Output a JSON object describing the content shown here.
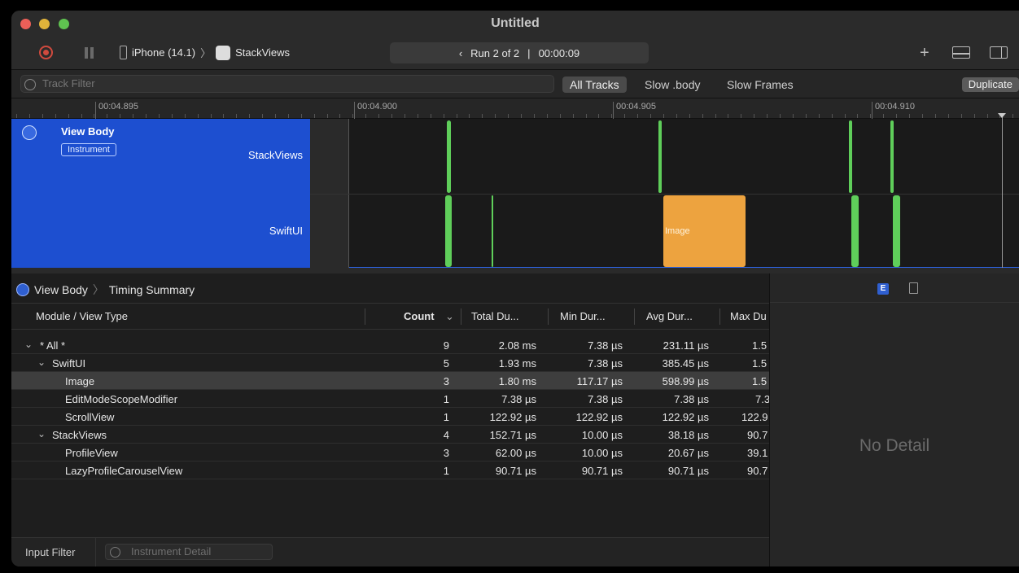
{
  "window": {
    "title": "Untitled"
  },
  "toolbar": {
    "device": "iPhone (14.1)",
    "app": "StackViews",
    "run_label": "Run 2 of 2",
    "run_separator": "|",
    "run_time": "00:00:09",
    "run_prev": "‹"
  },
  "filter": {
    "placeholder": "Track Filter",
    "tabs": [
      "All Tracks",
      "Slow .body",
      "Slow Frames"
    ],
    "duplicate": "Duplicate"
  },
  "ruler": {
    "ticks": [
      "00:04.895",
      "00:04.900",
      "00:04.905",
      "00:04.910"
    ]
  },
  "track": {
    "title": "View Body",
    "badge": "Instrument",
    "lanes": [
      "StackViews",
      "SwiftUI"
    ],
    "block_label": "Image"
  },
  "summary": {
    "breadcrumb": [
      "View Body",
      "Timing Summary"
    ],
    "columns": {
      "module": "Module / View Type",
      "count": "Count",
      "total": "Total Du...",
      "min": "Min Dur...",
      "avg": "Avg Dur...",
      "max": "Max Du"
    },
    "rows": [
      {
        "name": "* All *",
        "count": "9",
        "total": "2.08 ms",
        "min": "7.38 µs",
        "avg": "231.11 µs",
        "max": "1.5"
      },
      {
        "name": "SwiftUI",
        "count": "5",
        "total": "1.93 ms",
        "min": "7.38 µs",
        "avg": "385.45 µs",
        "max": "1.5"
      },
      {
        "name": "Image",
        "count": "3",
        "total": "1.80 ms",
        "min": "117.17 µs",
        "avg": "598.99 µs",
        "max": "1.5"
      },
      {
        "name": "EditModeScopeModifier",
        "count": "1",
        "total": "7.38 µs",
        "min": "7.38 µs",
        "avg": "7.38 µs",
        "max": "7.3"
      },
      {
        "name": "ScrollView",
        "count": "1",
        "total": "122.92 µs",
        "min": "122.92 µs",
        "avg": "122.92 µs",
        "max": "122.9"
      },
      {
        "name": "StackViews",
        "count": "4",
        "total": "152.71 µs",
        "min": "10.00 µs",
        "avg": "38.18 µs",
        "max": "90.7"
      },
      {
        "name": "ProfileView",
        "count": "3",
        "total": "62.00 µs",
        "min": "10.00 µs",
        "avg": "20.67 µs",
        "max": "39.1"
      },
      {
        "name": "LazyProfileCarouselView",
        "count": "1",
        "total": "90.71 µs",
        "min": "90.71 µs",
        "avg": "90.71 µs",
        "max": "90.7"
      }
    ]
  },
  "footer": {
    "input_filter": "Input Filter",
    "detail_placeholder": "Instrument Detail"
  },
  "inspector": {
    "empty_text": "No Detail",
    "tab_e": "E"
  }
}
